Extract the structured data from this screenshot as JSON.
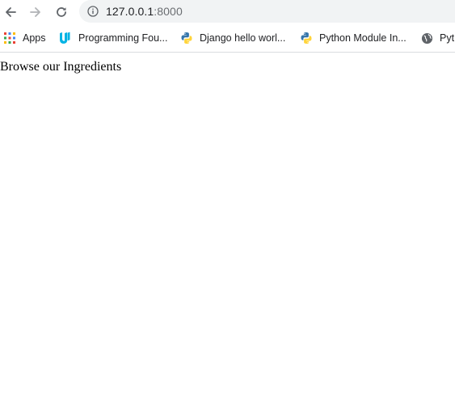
{
  "browser": {
    "url_host": "127.0.0.1",
    "url_port": ":8000"
  },
  "bookmarks": [
    {
      "label": "Apps",
      "icon": "apps-grid-icon"
    },
    {
      "label": "Programming Fou...",
      "icon": "udacity-icon"
    },
    {
      "label": "Django hello worl...",
      "icon": "python-icon"
    },
    {
      "label": "Python Module In...",
      "icon": "python-icon"
    },
    {
      "label": "Pyt",
      "icon": "globe-icon"
    }
  ],
  "page": {
    "heading": "Browse our Ingredients"
  },
  "colors": {
    "omnibox_bg": "#f1f3f4",
    "udacity": "#02b3e4",
    "python_blue": "#3776ab",
    "python_yellow": "#ffd43b"
  }
}
